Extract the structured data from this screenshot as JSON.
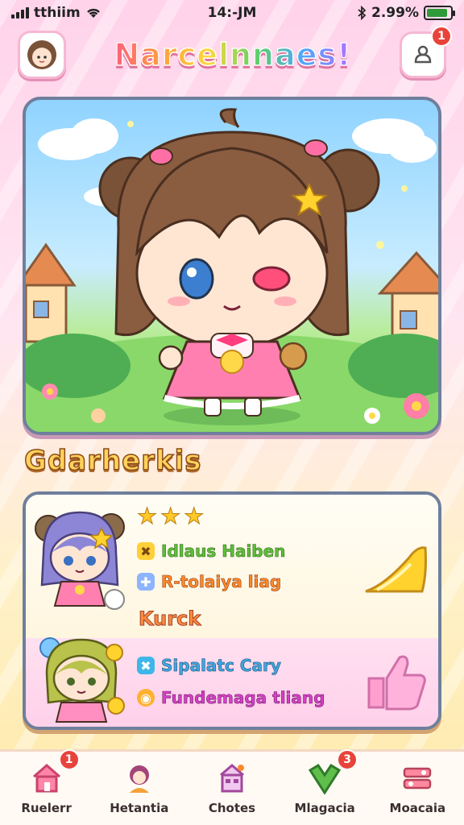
{
  "status_bar": {
    "carrier": "tthiim",
    "time": "14:-JM",
    "battery_text": "2.99%",
    "battery_level": 0.9
  },
  "header": {
    "title": "Narcelnnaes!",
    "avatar_icon": "girl-avatar-icon",
    "notification_icon": "bell-icon",
    "notification_count": "1"
  },
  "hero": {
    "character_icon": "chibi-girl-character",
    "scene": "village-meadow"
  },
  "section": {
    "title": "Gdarherkis"
  },
  "party": {
    "stars": [
      "★",
      "★",
      "★"
    ],
    "member1": {
      "icon": "purple-hair-girl-icon",
      "stat1_icon": "cross-icon",
      "stat1": "Idlaus Haiben",
      "stat2_icon": "puzzle-icon",
      "stat2": "R-tolaiya liag",
      "label": "Kurck",
      "action_icon": "cheese-icon"
    },
    "member2": {
      "icon": "blonde-girl-icon",
      "stat1_icon": "cross-icon",
      "stat1": "Sipalatc Cary",
      "stat2_icon": "coin-icon",
      "stat2": "Fundemaga tliang",
      "action_icon": "like-hand-icon"
    }
  },
  "nav": {
    "items": [
      {
        "label": "Ruelerr",
        "icon": "house-icon",
        "badge": "1"
      },
      {
        "label": "Hetantia",
        "icon": "character-icon",
        "badge": ""
      },
      {
        "label": "Chotes",
        "icon": "building-icon",
        "badge": ""
      },
      {
        "label": "Mlagacia",
        "icon": "green-arrow-icon",
        "badge": "3"
      },
      {
        "label": "Moacaia",
        "icon": "settings-sliders-icon",
        "badge": ""
      }
    ]
  },
  "colors": {
    "accent_pink": "#ff6fa5",
    "badge_red": "#e8433a",
    "gold": "#ffd35a"
  }
}
